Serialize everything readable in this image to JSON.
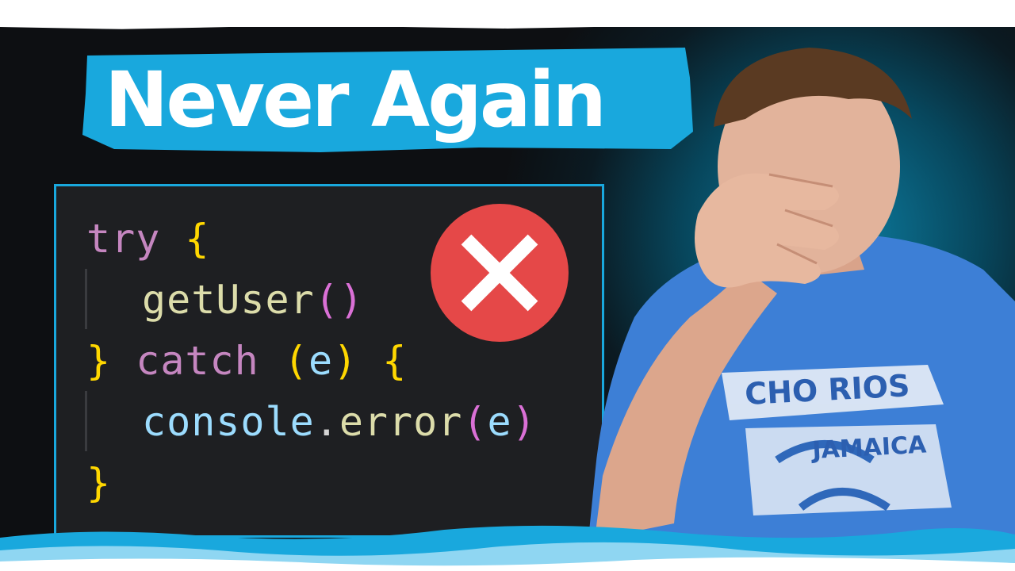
{
  "title": "Never Again",
  "code": {
    "line1": {
      "kw": "try",
      "brace": "{"
    },
    "line2": {
      "fn": "getUser",
      "open": "(",
      "close": ")"
    },
    "line3": {
      "brace_close": "}",
      "kw": "catch",
      "open": "(",
      "param": "e",
      "close": ")",
      "brace_open": "{"
    },
    "line4": {
      "obj": "console",
      "dot": ".",
      "fn": "error",
      "open": "(",
      "param": "e",
      "close": ")"
    },
    "line5": {
      "brace": "}"
    }
  },
  "shirt_text": {
    "top": "CHO RIOS",
    "bottom": "JAMAICA"
  },
  "icons": {
    "error": "x-circle-icon"
  },
  "colors": {
    "accent_blue": "#19a8dd",
    "error_red": "#e54848",
    "code_bg": "#1e1f22"
  }
}
